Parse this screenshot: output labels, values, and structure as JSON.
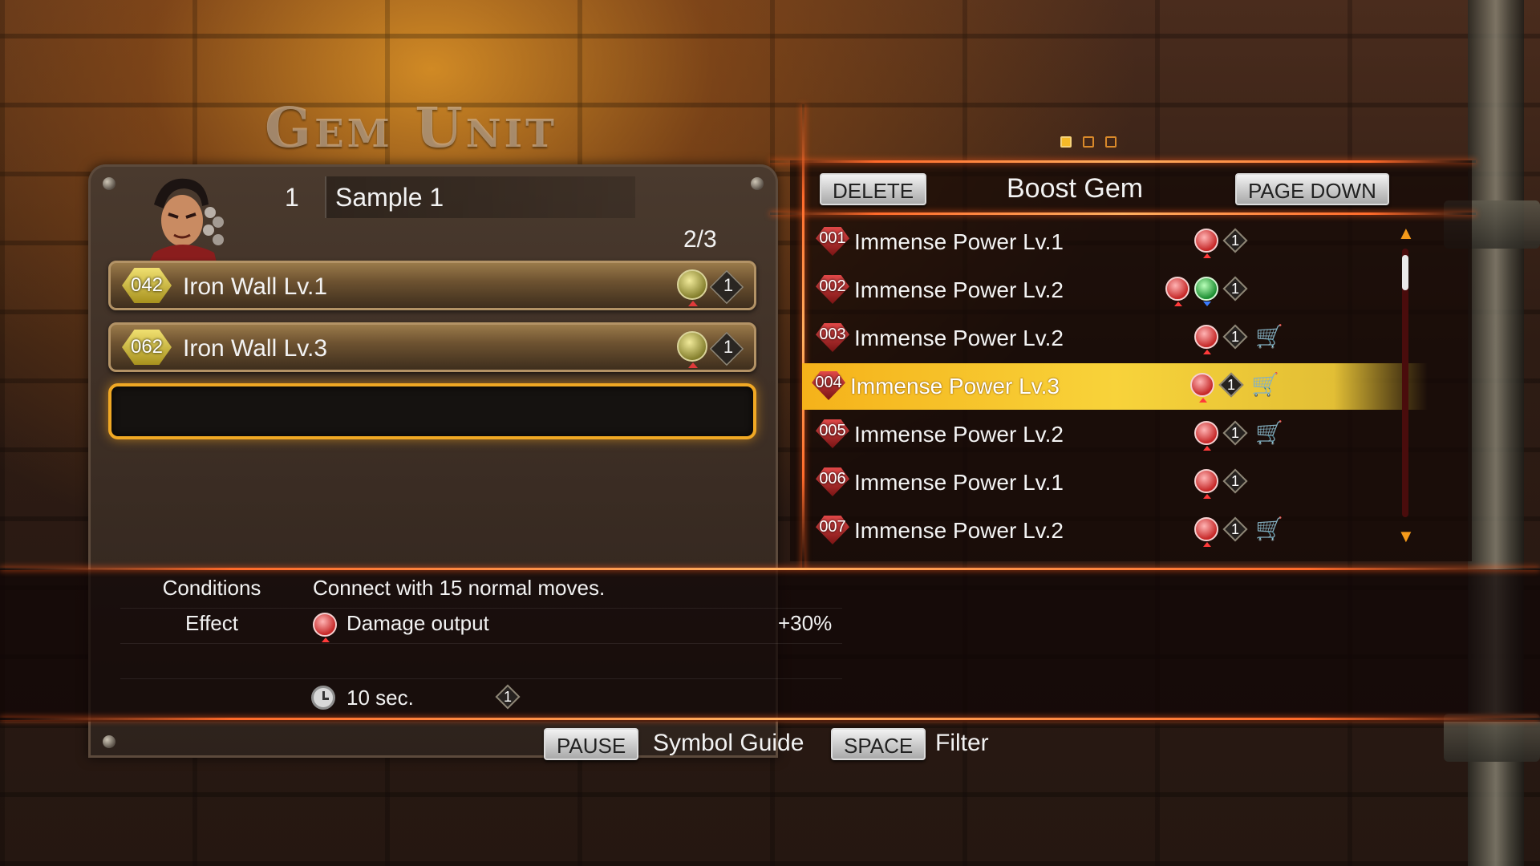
{
  "screen": {
    "title": "Gem Unit",
    "page_indicator": {
      "total": 3,
      "active": 1
    }
  },
  "deck": {
    "number": "1",
    "name": "Sample 1",
    "slots_used": "2/3",
    "character": "character-portrait-icon",
    "slots": [
      {
        "id": "042",
        "name": "Iron Wall Lv.1",
        "type_icon": "defense-gem-icon",
        "cost": "1"
      },
      {
        "id": "062",
        "name": "Iron Wall Lv.3",
        "type_icon": "defense-gem-icon",
        "cost": "1"
      }
    ]
  },
  "gem_list": {
    "delete_label": "DELETE",
    "title": "Boost Gem",
    "page_down_label": "PAGE DOWN",
    "selected_index": 3,
    "items": [
      {
        "id": "001",
        "name": "Immense Power Lv.1",
        "icons": [
          "power"
        ],
        "cost": "1",
        "cart": false
      },
      {
        "id": "002",
        "name": "Immense Power Lv.2",
        "icons": [
          "power",
          "speed"
        ],
        "cost": "1",
        "cart": false
      },
      {
        "id": "003",
        "name": "Immense Power Lv.2",
        "icons": [
          "power"
        ],
        "cost": "1",
        "cart": true
      },
      {
        "id": "004",
        "name": "Immense Power Lv.3",
        "icons": [
          "power"
        ],
        "cost": "1",
        "cart": true
      },
      {
        "id": "005",
        "name": "Immense Power Lv.2",
        "icons": [
          "power"
        ],
        "cost": "1",
        "cart": true
      },
      {
        "id": "006",
        "name": "Immense Power Lv.1",
        "icons": [
          "power"
        ],
        "cost": "1",
        "cart": false
      },
      {
        "id": "007",
        "name": "Immense Power Lv.2",
        "icons": [
          "power"
        ],
        "cost": "1",
        "cart": true
      }
    ],
    "scroll_position": 0.05
  },
  "details": {
    "conditions_label": "Conditions",
    "conditions_value": "Connect with 15 normal moves.",
    "effect_label": "Effect",
    "effect_name": "Damage output",
    "effect_value": "+30%",
    "duration": "10 sec.",
    "cost": "1"
  },
  "footer": {
    "pause_key": "PAUSE",
    "pause_action": "Symbol Guide",
    "space_key": "SPACE",
    "space_action": "Filter"
  },
  "colors": {
    "accent_line": "#ff6a2a",
    "selection": "#f8d33a",
    "slot_highlight": "#f0a824"
  }
}
